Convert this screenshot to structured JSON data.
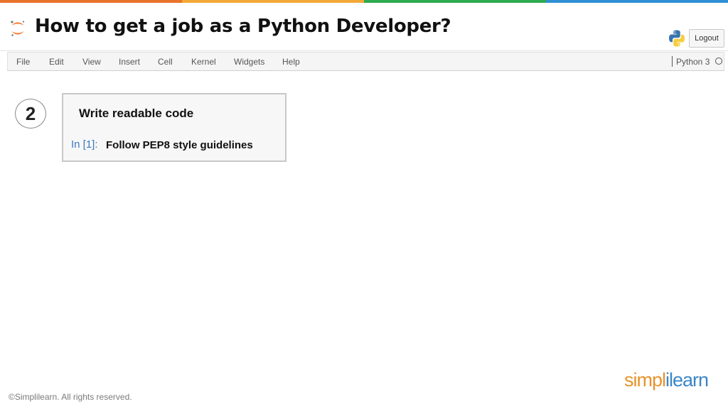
{
  "colors": {
    "topbar": [
      "#e8732a",
      "#f3a838",
      "#2eaa4f",
      "#2e8fd4"
    ],
    "jupyter_orange": "#f37726",
    "prompt_blue": "#3b7bbf",
    "brand_orange": "#e8932c",
    "brand_blue": "#3a86c8"
  },
  "header": {
    "logo_icon": "jupyter-logo-icon",
    "title": "How to get a job as a Python Developer?",
    "python_icon": "python-logo-icon",
    "logout_label": "Logout"
  },
  "menubar": {
    "items": [
      "File",
      "Edit",
      "View",
      "Insert",
      "Cell",
      "Kernel",
      "Widgets",
      "Help"
    ],
    "kernel_name": "Python 3",
    "kernel_status_icon": "kernel-idle-circle-icon"
  },
  "step": {
    "number": "2"
  },
  "cell": {
    "heading": "Write readable code",
    "prompt": "In [1]:",
    "code": "Follow PEP8 style guidelines"
  },
  "footer": {
    "copyright": "©Simplilearn. All rights reserved.",
    "brand_part1": "simpl",
    "brand_part2": "ilearn"
  }
}
